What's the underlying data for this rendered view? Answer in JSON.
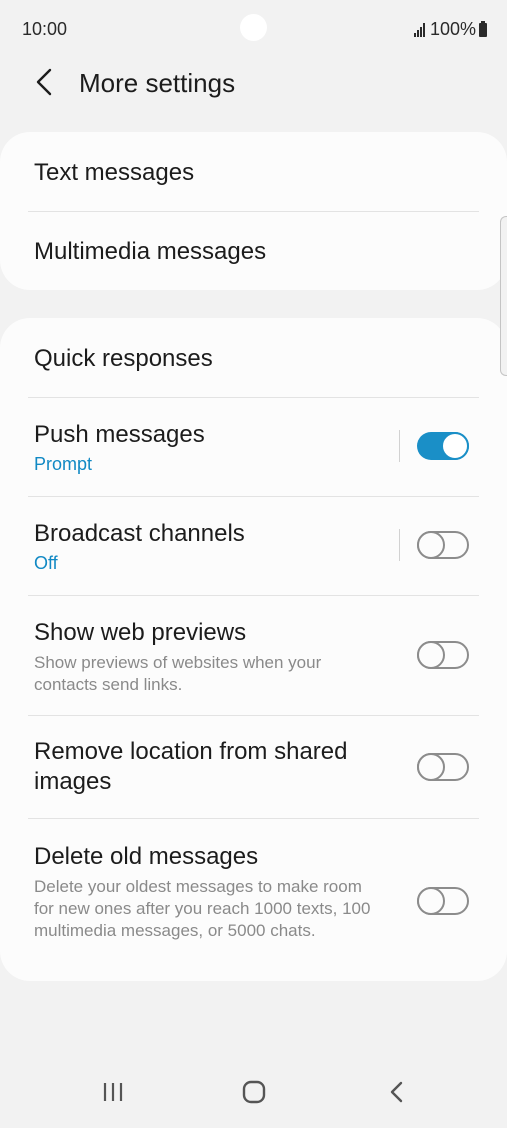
{
  "status_bar": {
    "time": "10:00",
    "battery": "100%"
  },
  "header": {
    "title": "More settings",
    "back_icon": "chevron-left-icon"
  },
  "groups": [
    {
      "items": [
        {
          "title": "Text messages"
        },
        {
          "title": "Multimedia messages"
        }
      ]
    },
    {
      "items": [
        {
          "title": "Quick responses"
        },
        {
          "title": "Push messages",
          "subtitle": "Prompt",
          "toggle": true
        },
        {
          "title": "Broadcast channels",
          "subtitle": "Off",
          "toggle": false
        },
        {
          "title": "Show web previews",
          "description": "Show previews of websites when your contacts send links.",
          "toggle": false
        },
        {
          "title": "Remove location from shared images",
          "toggle": false
        },
        {
          "title": "Delete old messages",
          "description": "Delete your oldest messages to make room for new ones after you reach 1000 texts, 100 multimedia messages, or 5000 chats.",
          "toggle": false
        }
      ]
    }
  ],
  "nav_bar": {
    "icons": [
      "recents-icon",
      "home-icon",
      "back-icon"
    ]
  },
  "colors": {
    "accent": "#1a8fc7",
    "background": "#f2f2f2",
    "card": "#fcfcfc",
    "subtitle": "#1189c4",
    "description": "#8a8a8a"
  }
}
